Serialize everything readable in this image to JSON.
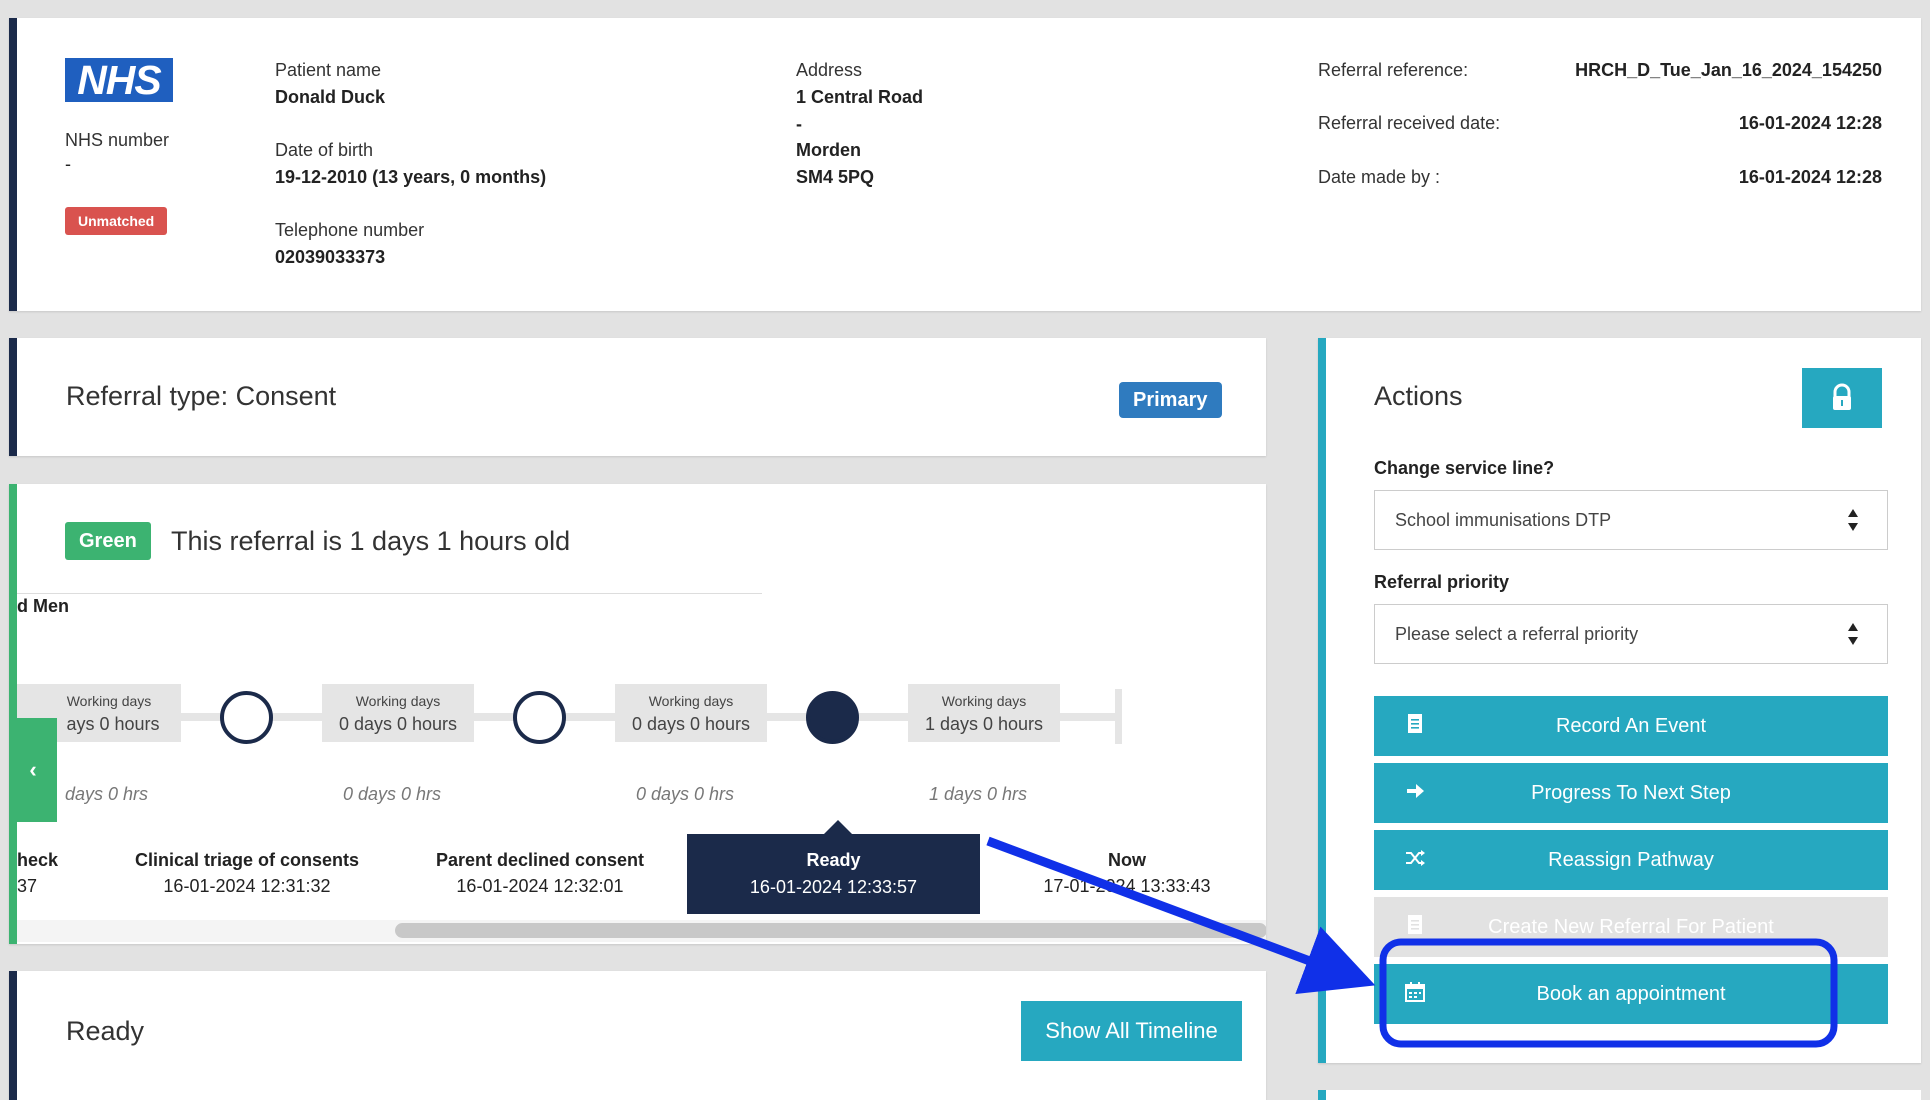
{
  "patient": {
    "logo_text": "NHS",
    "nhs_number_label": "NHS number",
    "nhs_number_value": "-",
    "match_badge": "Unmatched",
    "name_label": "Patient name",
    "name_value": "Donald Duck",
    "dob_label": "Date of birth",
    "dob_value": "19-12-2010 (13 years, 0 months)",
    "phone_label": "Telephone number",
    "phone_value": "02039033373",
    "address_label": "Address",
    "address_lines": [
      "1 Central Road",
      "-",
      "Morden",
      "SM4 5PQ"
    ],
    "referral_reference_label": "Referral reference:",
    "referral_reference_value": "HRCH_D_Tue_Jan_16_2024_154250",
    "received_date_label": "Referral received date:",
    "received_date_value": "16-01-2024 12:28",
    "date_made_by_label": "Date made by :",
    "date_made_by_value": "16-01-2024 12:28"
  },
  "referral_type": {
    "title": "Referral type: Consent",
    "badge": "Primary"
  },
  "timeline": {
    "status_badge": "Green",
    "age_text": "This referral is 1 days 1 hours old",
    "clipped_label": "d Men",
    "durations": [
      {
        "small": "Working days",
        "big": "ays 0 hours",
        "italic": "days 0 hrs"
      },
      {
        "small": "Working days",
        "big": "0 days 0 hours",
        "italic": "0 days 0 hrs"
      },
      {
        "small": "Working days",
        "big": "0 days 0 hours",
        "italic": "0 days 0 hrs"
      },
      {
        "small": "Working days",
        "big": "1 days 0 hours",
        "italic": "1 days 0 hrs"
      }
    ],
    "events": [
      {
        "name": "heck",
        "date": "37"
      },
      {
        "name": "Clinical triage of consents",
        "date": "16-01-2024 12:31:32"
      },
      {
        "name": "Parent declined consent",
        "date": "16-01-2024 12:32:01"
      },
      {
        "name": "Ready",
        "date": "16-01-2024 12:33:57"
      },
      {
        "name": "Now",
        "date": "17-01-2024 13:33:43"
      }
    ],
    "prev_icon": "chevron-left-icon"
  },
  "ready_section": {
    "title": "Ready",
    "show_all_button": "Show All Timeline"
  },
  "actions": {
    "title": "Actions",
    "lock_icon": "lock-icon",
    "service_line_label": "Change service line?",
    "service_line_value": "School immunisations DTP",
    "priority_label": "Referral priority",
    "priority_placeholder": "Please select a referral priority",
    "buttons": [
      {
        "label": "Record An Event",
        "icon": "document-icon",
        "enabled": true
      },
      {
        "label": "Progress To Next Step",
        "icon": "arrow-right-icon",
        "enabled": true
      },
      {
        "label": "Reassign Pathway",
        "icon": "shuffle-icon",
        "enabled": true
      },
      {
        "label": "Create New Referral For Patient",
        "icon": "document-icon",
        "enabled": false
      },
      {
        "label": "Book an appointment",
        "icon": "calendar-icon",
        "enabled": true
      }
    ]
  },
  "colors": {
    "navy": "#1b2a4a",
    "teal": "#26a8c0",
    "green": "#3cb371",
    "red": "#d9534f",
    "primary_blue": "#2f7bbf",
    "annotation_blue": "#1030e8"
  }
}
